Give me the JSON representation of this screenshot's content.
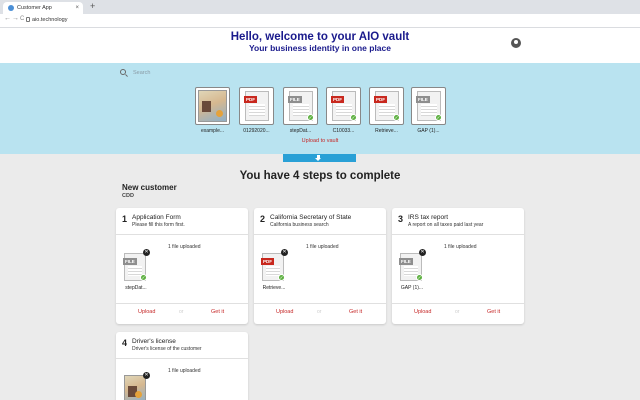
{
  "browser": {
    "tab_title": "Customer App",
    "tab_close": "×",
    "new_tab": "+",
    "url": "aio.technology",
    "back": "←",
    "forward": "→",
    "reload": "C"
  },
  "header": {
    "title": "Hello, welcome to your AIO vault",
    "subtitle": "Your business identity in one place"
  },
  "vault": {
    "search_placeholder": "Search",
    "files": [
      {
        "name": "example...",
        "kind": "image"
      },
      {
        "name": "01292020...",
        "kind": "pdf"
      },
      {
        "name": "stepDat...",
        "kind": "file"
      },
      {
        "name": "C10033...",
        "kind": "pdf"
      },
      {
        "name": "Retrieve...",
        "kind": "pdf"
      },
      {
        "name": "GAP (1)...",
        "kind": "file"
      }
    ],
    "upload_label": "Upload to vault"
  },
  "steps_title": "You have 4 steps to complete",
  "customer": {
    "name": "New customer",
    "code": "CDD"
  },
  "labels": {
    "pdf_badge": "PDF",
    "file_badge": "FILE",
    "check": "✓",
    "delete": "✕"
  },
  "steps": [
    {
      "num": "1",
      "title": "Application Form",
      "desc": "Please fill this form first.",
      "count": "1 file uploaded",
      "file": "stepDat...",
      "kind": "file",
      "upload": "Upload",
      "or": "or",
      "get": "Get it"
    },
    {
      "num": "2",
      "title": "California Secretary of State",
      "desc": "California business search",
      "count": "1 file uploaded",
      "file": "Retrieve...",
      "kind": "pdf",
      "upload": "Upload",
      "or": "or",
      "get": "Get it"
    },
    {
      "num": "3",
      "title": "IRS tax report",
      "desc": "A report on all taxes paid last year",
      "count": "1 file uploaded",
      "file": "GAP (1)...",
      "kind": "file",
      "upload": "Upload",
      "or": "or",
      "get": "Get it"
    },
    {
      "num": "4",
      "title": "Driver's license",
      "desc": "Driver's license of the customer",
      "count": "1 file uploaded",
      "kind": "image"
    }
  ],
  "colors": {
    "header_text": "#1a1a8c",
    "vault_band": "#b9e3f0",
    "accent_red": "#c62828",
    "upload_tab": "#29a0d6"
  }
}
